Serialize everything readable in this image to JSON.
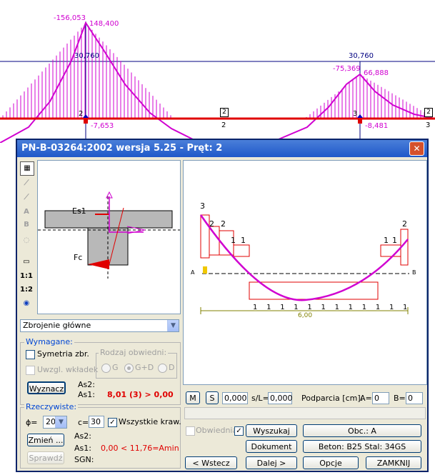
{
  "background": {
    "top_labels": {
      "m1a": "-156,053",
      "m1b": "148,400",
      "m2a": "-75,369",
      "m2b": "66,888",
      "h1": "30,760",
      "h2": "30,760",
      "v1": "-7,653",
      "v2": "-8,481",
      "node_a": "2",
      "node_b": "3",
      "span_box_left": "2",
      "span_mid": "2",
      "span_box_right": "2",
      "node_c": "3"
    },
    "colors": {
      "moment": "#d000d0",
      "beam": "#e00000",
      "axis": "#000080"
    }
  },
  "dialog": {
    "title": "PN-B-03264:2002 wersja 5.25 - Pręt: 2",
    "close_icon": "close-icon",
    "section_view": {
      "label_es1": "Es1",
      "label_fc": "Fc"
    },
    "beam_view": {
      "labels_top": [
        "3",
        "2",
        "2",
        "1",
        "1",
        "1",
        "1",
        "2"
      ],
      "support_a": "A",
      "support_b": "B",
      "stirrup_labels": [
        "1",
        "1",
        "1",
        "1",
        "1",
        "1",
        "1",
        "1",
        "1",
        "1",
        "1",
        "1"
      ],
      "span_length": "6,00"
    },
    "toolbar": {
      "scale_11": "1:1",
      "scale_12": "1:2"
    },
    "combo_type": "Zbrojenie główne",
    "wymagane": {
      "title": "Wymagane:",
      "symetria": "Symetria zbr.",
      "uwzgl": "Uwzgl. wkładek",
      "rodzaj_title": "Rodzaj obwiedni:",
      "radio_g": "G",
      "radio_gd": "G+D",
      "radio_d": "D",
      "btn_wyznacz": "Wyznacz",
      "as2": "As2:",
      "as1": "As1:",
      "as1_value": "8,01 (3) > 0,00"
    },
    "rzeczywiste": {
      "title": "Rzeczywiste:",
      "phi_label": "ϕ=",
      "phi_value": "20",
      "c_label": "c=",
      "c_value": "30",
      "wszystkie": "Wszystkie kraw.",
      "btn_zmien": "Zmień ...",
      "btn_sprawdz": "Sprawdź",
      "as2": "As2:",
      "as1": "As1:",
      "as1_value": "0,00 < 11,76=Amin",
      "sgn": "SGN:"
    },
    "controls": {
      "btn_m": "M",
      "btn_s": "S",
      "pos_value": "0,000",
      "sl_label": "s/L=",
      "sl_value": "0,000",
      "podparcia": "Podparcia [cm]:",
      "a_label": "A=",
      "a_value": "0",
      "b_label": "B=",
      "b_value": "0"
    },
    "buttons": {
      "obwiednia": "Obwiednia",
      "wyszukaj": "Wyszukaj",
      "obc": "Obc.: A",
      "dokument": "Dokument",
      "beton": "Beton: B25   Stal: 34GS",
      "wstecz": "< Wstecz",
      "dalej": "Dalej >",
      "opcje": "Opcje",
      "zamknij": "ZAMKNIJ"
    }
  }
}
